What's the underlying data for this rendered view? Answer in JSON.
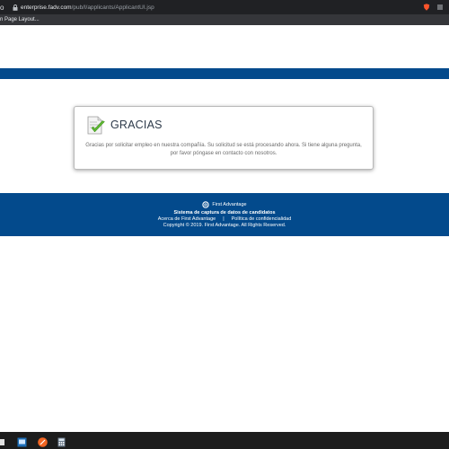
{
  "browser": {
    "nav_fragment": "o",
    "url_domain": "enterprise.fadv.com",
    "url_path": "/pub/l/applicants/ApplicantUI.jsp",
    "bookmark": "n Page Layout..."
  },
  "card": {
    "title": "GRACIAS",
    "message": "Gracias por solicitar empleo en nuestra compañía. Su solicitud se está procesando ahora. Si tiene alguna pregunta, por favor póngase en contacto con nosotros."
  },
  "footer": {
    "brand": "First Advantage",
    "system": "Sistema de captura de datos de candidatos",
    "about_link": "Acerca de First Advantage",
    "separator": "|",
    "privacy_link": "Política de confidencialidad",
    "copyright": "Copyright © 2019. First Advantage. All Rights Reserved."
  },
  "colors": {
    "brand_blue": "#034a8c",
    "browser_dark": "#202124"
  },
  "icons": {
    "card": "check-document-icon",
    "footer": "first-advantage-logo-icon"
  }
}
